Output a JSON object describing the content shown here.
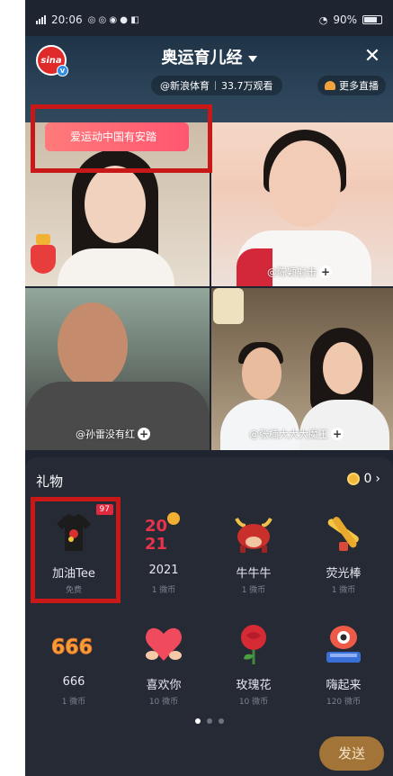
{
  "status_bar": {
    "time": "20:06",
    "battery": "90%"
  },
  "header": {
    "title": "奥运育儿经",
    "source": "@新浪体育",
    "viewers": "33.7万观看",
    "more_live": "更多直播",
    "logo_text": "sina"
  },
  "banner": {
    "text": "爱运动中国有安踏"
  },
  "participants": [
    {
      "name": ""
    },
    {
      "name": "@陈颖射击"
    },
    {
      "name": "@孙雷没有红"
    },
    {
      "name": "@张楠大大大魔王"
    }
  ],
  "gift_panel": {
    "title": "礼物",
    "balance": "0",
    "gifts": [
      {
        "name": "加油Tee",
        "price": "免费",
        "badge": "97",
        "icon": "tshirt-icon"
      },
      {
        "name": "2021",
        "price": "1 微币",
        "icon": "2021-balloon-icon"
      },
      {
        "name": "牛牛牛",
        "price": "1 微币",
        "icon": "bull-icon"
      },
      {
        "name": "荧光棒",
        "price": "1 微币",
        "icon": "glowstick-icon"
      },
      {
        "name": "666",
        "price": "1 微币",
        "icon": "666-icon"
      },
      {
        "name": "喜欢你",
        "price": "10 微币",
        "icon": "heart-icon"
      },
      {
        "name": "玫瑰花",
        "price": "10 微币",
        "icon": "rose-icon"
      },
      {
        "name": "嗨起来",
        "price": "120 微币",
        "icon": "robot-dj-icon"
      }
    ],
    "send_label": "发送"
  },
  "colors": {
    "accent_red": "#c91818",
    "send_button": "#a27437",
    "panel_bg": "#262a35"
  }
}
